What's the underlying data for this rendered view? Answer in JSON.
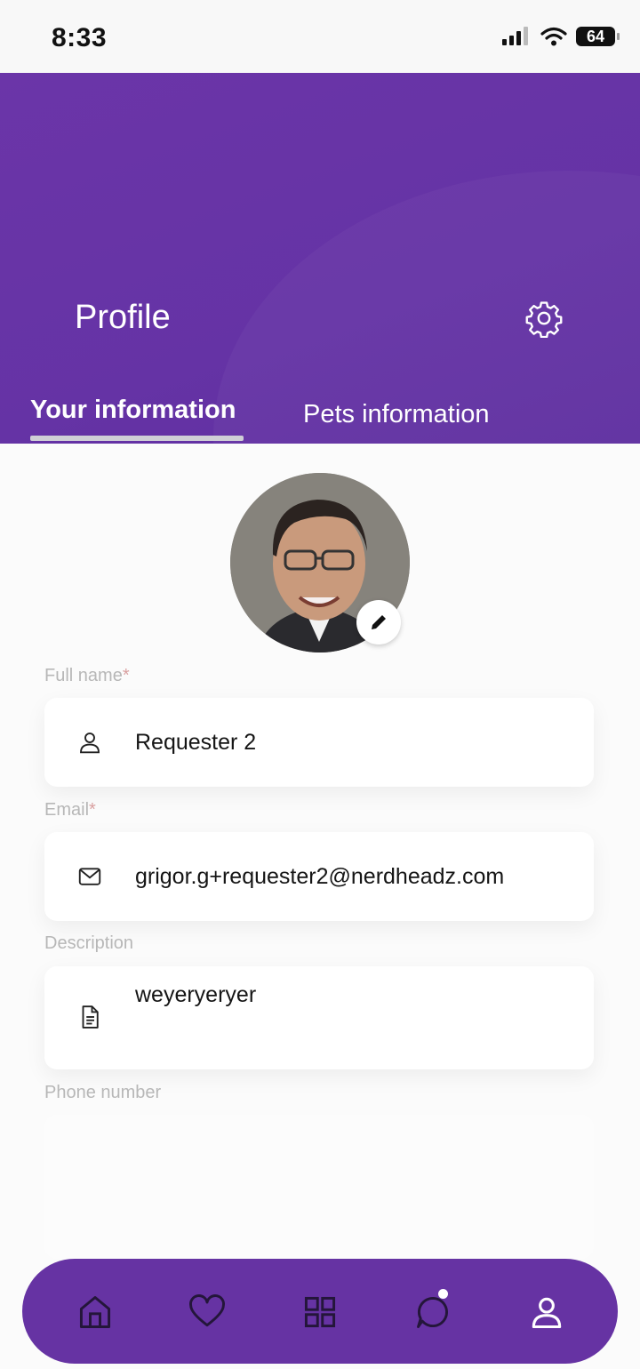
{
  "status_bar": {
    "time": "8:33",
    "battery": "64"
  },
  "header": {
    "title": "Profile",
    "tabs": [
      {
        "label": "Your information",
        "active": true
      },
      {
        "label": "Pets information",
        "active": false
      }
    ]
  },
  "form": {
    "full_name": {
      "label": "Full name",
      "required_mark": "*",
      "value": "Requester 2",
      "icon": "user-icon"
    },
    "email": {
      "label": "Email",
      "required_mark": "*",
      "value": "grigor.g+requester2@nerdheadz.com",
      "icon": "mail-icon"
    },
    "description": {
      "label": "Description",
      "value": "weyeryeryer",
      "icon": "document-icon"
    },
    "phone": {
      "label": "Phone number",
      "value": ""
    }
  },
  "nav": {
    "items": [
      {
        "name": "home",
        "icon": "home-icon"
      },
      {
        "name": "favorites",
        "icon": "heart-icon"
      },
      {
        "name": "catalog",
        "icon": "grid-icon"
      },
      {
        "name": "chat",
        "icon": "chat-icon"
      },
      {
        "name": "profile",
        "icon": "user-icon"
      }
    ]
  },
  "colors": {
    "brand": "#6633a3",
    "header": "#6a35a7",
    "label": "#b7b7b7",
    "required": "#d9a0a0"
  }
}
